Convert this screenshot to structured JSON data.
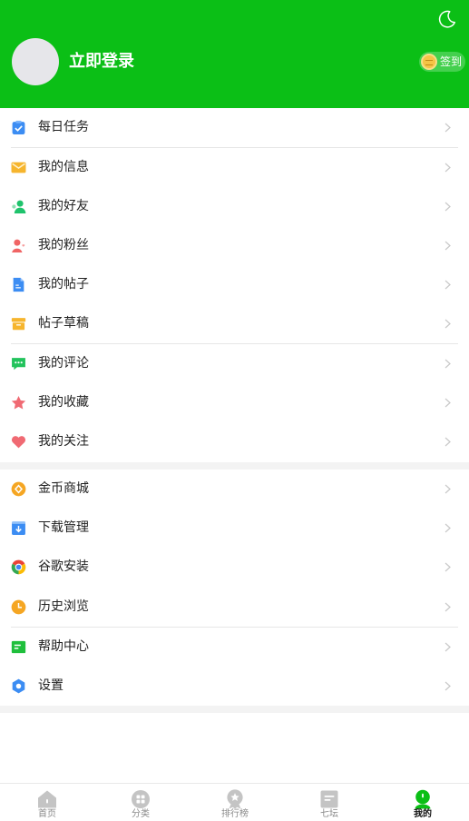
{
  "header": {
    "login_label": "立即登录",
    "signin_label": "签到",
    "theme_icon": "moon-icon",
    "bg_color": "#0bbf16"
  },
  "menu_groups": [
    [
      {
        "label": "每日任务",
        "icon": "daily-task-icon"
      },
      {
        "label": "我的信息",
        "icon": "mail-icon"
      },
      {
        "label": "我的好友",
        "icon": "friends-icon"
      },
      {
        "label": "我的粉丝",
        "icon": "fans-icon"
      },
      {
        "label": "我的帖子",
        "icon": "post-icon"
      },
      {
        "label": "帖子草稿",
        "icon": "draft-icon"
      }
    ],
    [
      {
        "label": "我的评论",
        "icon": "comment-icon"
      },
      {
        "label": "我的收藏",
        "icon": "star-icon"
      },
      {
        "label": "我的关注",
        "icon": "heart-icon"
      }
    ],
    [
      {
        "label": "金币商城",
        "icon": "coin-mall-icon"
      },
      {
        "label": "下载管理",
        "icon": "download-icon"
      },
      {
        "label": "谷歌安装",
        "icon": "chrome-icon"
      },
      {
        "label": "历史浏览",
        "icon": "history-icon"
      }
    ],
    [
      {
        "label": "帮助中心",
        "icon": "help-icon"
      },
      {
        "label": "设置",
        "icon": "settings-icon"
      }
    ]
  ],
  "tabbar": {
    "items": [
      {
        "label": "首页",
        "icon": "home-icon",
        "active": false
      },
      {
        "label": "分类",
        "icon": "category-icon",
        "active": false
      },
      {
        "label": "排行榜",
        "icon": "ranking-icon",
        "active": false
      },
      {
        "label": "七坛",
        "icon": "forum-icon",
        "active": false
      },
      {
        "label": "我的",
        "icon": "profile-icon",
        "active": true
      }
    ],
    "active_color": "#0bbf16",
    "inactive_color": "#c4c4c4"
  }
}
